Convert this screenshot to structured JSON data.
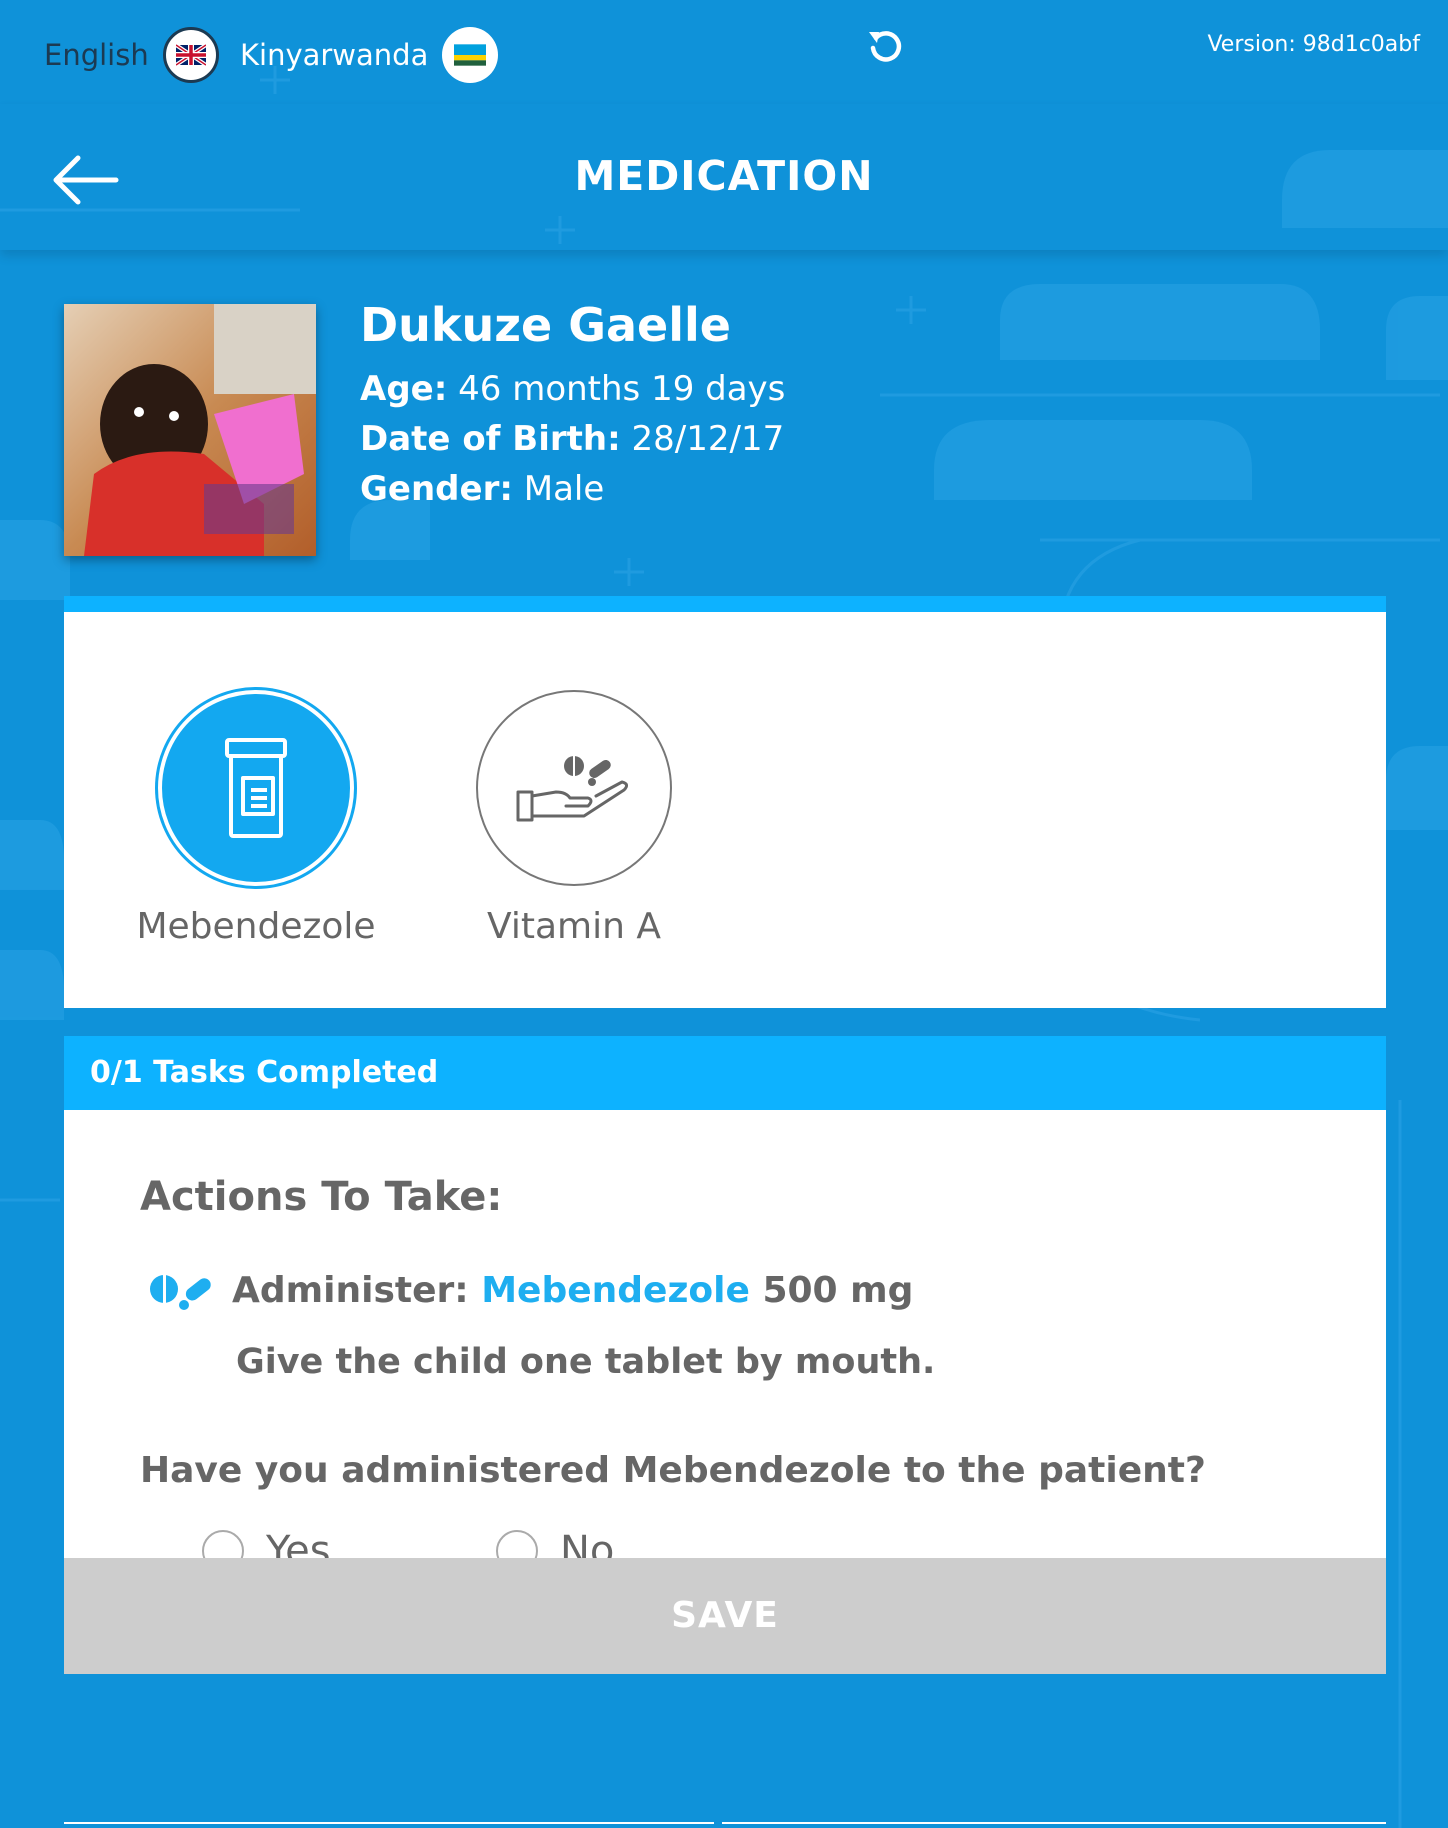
{
  "topbar": {
    "lang_en": "English",
    "lang_rw": "Kinyarwanda",
    "version": "Version: 98d1c0abf"
  },
  "header": {
    "title": "MEDICATION"
  },
  "patient": {
    "name": "Dukuze Gaelle",
    "age_label": "Age:",
    "age_value": "46 months 19 days",
    "dob_label": "Date of Birth:",
    "dob_value": "28/12/17",
    "gender_label": "Gender:",
    "gender_value": "Male"
  },
  "medications": [
    {
      "label": "Mebendezole",
      "icon": "pill-bottle-icon",
      "selected": true
    },
    {
      "label": "Vitamin A",
      "icon": "hand-pills-icon",
      "selected": false
    }
  ],
  "tasks": {
    "status": "0/1 Tasks Completed"
  },
  "actions": {
    "title": "Actions To Take:",
    "administer_label": "Administer:",
    "drug": "Mebendezole",
    "dose": "500 mg",
    "instruction": "Give the child one tablet by mouth.",
    "question": "Have you administered Mebendezole to the patient?",
    "options": [
      "Yes",
      "No"
    ]
  },
  "save_label": "SAVE",
  "colors": {
    "background": "#0f92d9",
    "accent": "#0db2ff",
    "drug_text": "#1eaef0",
    "save_disabled": "#cdcdcd"
  }
}
